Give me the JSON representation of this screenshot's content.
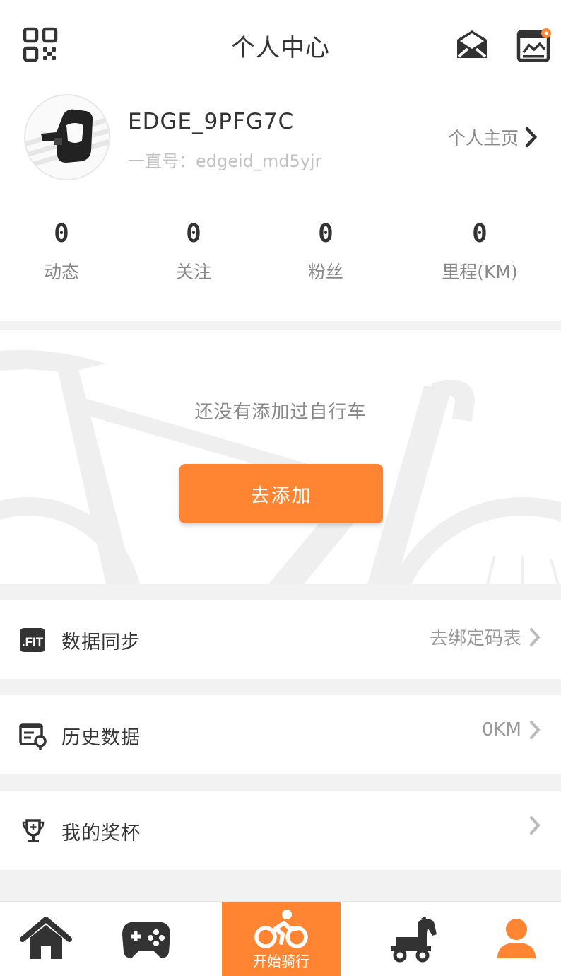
{
  "header": {
    "title": "个人中心"
  },
  "profile": {
    "username": "EDGE_9PFG7C",
    "id_label": "一直号：edgeid_md5yjr",
    "homepage_label": "个人主页"
  },
  "stats": [
    {
      "value": "0",
      "label": "动态"
    },
    {
      "value": "0",
      "label": "关注"
    },
    {
      "value": "0",
      "label": "粉丝"
    },
    {
      "value": "0",
      "label": "里程(KM)"
    }
  ],
  "bike": {
    "empty_text": "还没有添加过自行车",
    "add_button": "去添加"
  },
  "menu": [
    {
      "icon": "fit-file-icon",
      "label": "数据同步",
      "value": "去绑定码表"
    },
    {
      "icon": "history-data-icon",
      "label": "历史数据",
      "value": "0KM"
    },
    {
      "icon": "trophy-icon",
      "label": "我的奖杯",
      "value": ""
    }
  ],
  "tabbar": {
    "ride_label": "开始骑行",
    "icons": [
      "home-icon",
      "gamepad-icon",
      "bike-icon",
      "trojan-horse-icon",
      "user-icon"
    ]
  },
  "colors": {
    "accent": "#ff8533",
    "text": "#333333",
    "secondary": "#888888",
    "dark_icon": "#333333"
  }
}
